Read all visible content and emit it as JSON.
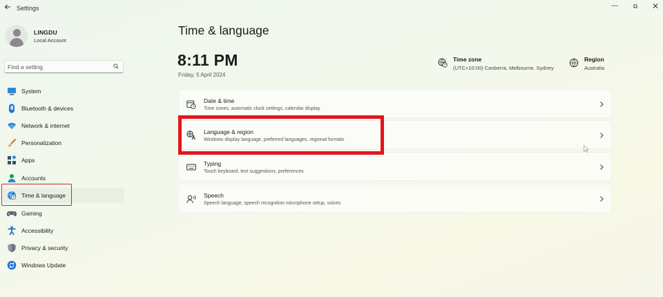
{
  "window": {
    "app_title": "Settings",
    "back_icon": "arrow-left-icon",
    "controls": {
      "minimize": "—",
      "maximize": "⧉",
      "close": "✕"
    }
  },
  "profile": {
    "name": "LINGDU",
    "account_type": "Local Account"
  },
  "search": {
    "placeholder": "Find a setting",
    "value": ""
  },
  "sidebar": {
    "items": [
      {
        "label": "System",
        "icon": "monitor-icon",
        "active": false
      },
      {
        "label": "Bluetooth & devices",
        "icon": "bluetooth-icon",
        "active": false
      },
      {
        "label": "Network & internet",
        "icon": "wifi-icon",
        "active": false
      },
      {
        "label": "Personalization",
        "icon": "brush-icon",
        "active": false
      },
      {
        "label": "Apps",
        "icon": "apps-icon",
        "active": false
      },
      {
        "label": "Accounts",
        "icon": "person-icon",
        "active": false
      },
      {
        "label": "Time & language",
        "icon": "globe-clock-icon",
        "active": true
      },
      {
        "label": "Gaming",
        "icon": "gamepad-icon",
        "active": false
      },
      {
        "label": "Accessibility",
        "icon": "accessibility-icon",
        "active": false
      },
      {
        "label": "Privacy & security",
        "icon": "shield-icon",
        "active": false
      },
      {
        "label": "Windows Update",
        "icon": "update-icon",
        "active": false
      }
    ]
  },
  "main": {
    "title": "Time & language",
    "time": "8:11 PM",
    "date": "Friday, 5 April 2024",
    "time_zone": {
      "title": "Time zone",
      "value": "(UTC+10:00) Canberra, Melbourne, Sydney"
    },
    "region": {
      "title": "Region",
      "value": "Australia"
    },
    "cards": [
      {
        "title": "Date & time",
        "description": "Time zones, automatic clock settings, calendar display",
        "icon": "calendar-clock-icon"
      },
      {
        "title": "Language & region",
        "description": "Windows display language, preferred languages, regional formats",
        "icon": "language-icon"
      },
      {
        "title": "Typing",
        "description": "Touch keyboard, text suggestions, preferences",
        "icon": "keyboard-icon"
      },
      {
        "title": "Speech",
        "description": "Speech language, speech recognition microphone setup, voices",
        "icon": "speech-icon"
      }
    ]
  },
  "colors": {
    "highlight_red": "#e3161b",
    "accent_blue": "#0067c0"
  }
}
